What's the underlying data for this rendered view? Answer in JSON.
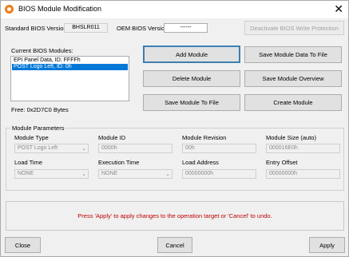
{
  "window": {
    "title": "BIOS Module Modification",
    "close_glyph": "✕"
  },
  "header": {
    "standard_bios_label": "Standard BIOS Version:",
    "standard_bios_value": "BHSLR011",
    "oem_bios_label": "OEM BIOS Version:",
    "oem_bios_value": "------",
    "deactivate_button": "Deactivate BIOS Write Protection"
  },
  "modules": {
    "label": "Current BIOS Modules:",
    "items": [
      {
        "label": "EPI Panel Data, ID: FFFFh",
        "selected": false
      },
      {
        "label": "POST Logo Left, ID: 0h",
        "selected": true
      }
    ],
    "free_text": "Free: 0x2D7C0 Bytes"
  },
  "actions": {
    "add_module": "Add  Module",
    "save_module_data": "Save Module Data To File",
    "delete_module": "Delete Module",
    "save_module_overview": "Save Module Overview",
    "save_module_to_file": "Save Module To File",
    "create_module": "Create Module"
  },
  "params": {
    "group_title": "Module Parameters",
    "module_type_label": "Module Type",
    "module_type_value": "POST Logo Left",
    "module_id_label": "Module ID",
    "module_id_value": "0000h",
    "module_revision_label": "Module Revision",
    "module_revision_value": "00h",
    "module_size_label": "Module Size (auto)",
    "module_size_value": "000016E0h",
    "load_time_label": "Load Time",
    "load_time_value": "NONE",
    "execution_time_label": "Execution Time",
    "execution_time_value": "NONE",
    "load_address_label": "Load Address",
    "load_address_value": "00000000h",
    "entry_offset_label": "Entry Offset",
    "entry_offset_value": "00000000h"
  },
  "status": {
    "message": "Press 'Apply' to apply changes to the operation target or 'Cancel' to undo."
  },
  "footer": {
    "close": "Close",
    "cancel": "Cancel",
    "apply": "Apply"
  },
  "colors": {
    "accent": "#0078d7",
    "status_text": "#c00000",
    "app_icon": "#f07d1a"
  },
  "icons": {
    "app": "orange-ring-icon",
    "close": "close-icon",
    "dropdown": "chevron-down-icon"
  }
}
